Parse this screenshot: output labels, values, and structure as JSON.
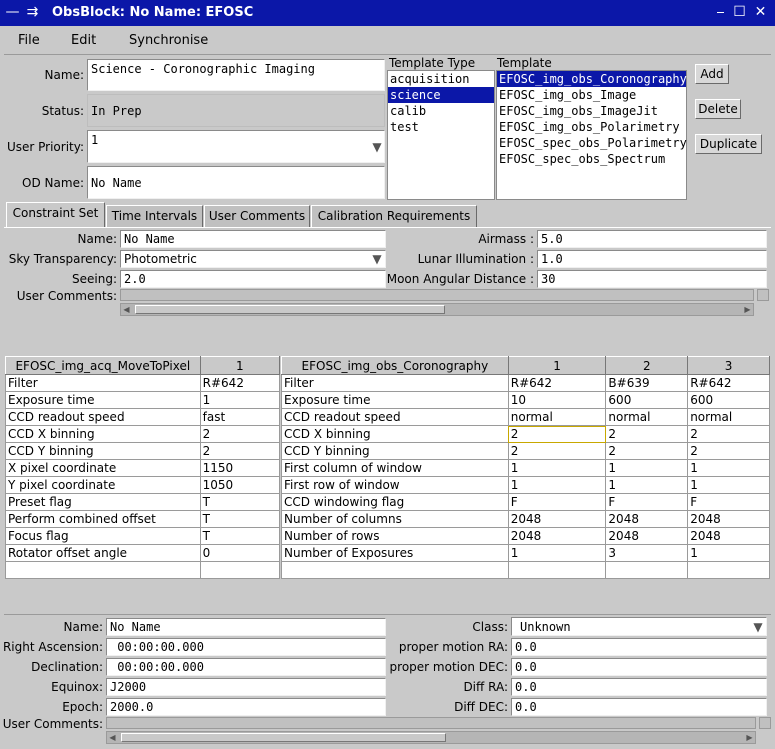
{
  "window": {
    "title": "ObsBlock: No Name: EFOSC"
  },
  "menu": [
    "File",
    "Edit",
    "Synchronise"
  ],
  "obsblock": {
    "name_label": "Name:",
    "name_value": "Science - Coronographic Imaging",
    "status_label": "Status:",
    "status_value": "In Prep",
    "priority_label": "User Priority:",
    "priority_value": "1",
    "odname_label": "OD Name:",
    "odname_value": "No Name"
  },
  "template_type": {
    "header": "Template Type",
    "items": [
      "acquisition",
      "science",
      "calib",
      "test"
    ],
    "selected": 1
  },
  "template": {
    "header": "Template",
    "items": [
      "EFOSC_img_obs_Coronography",
      "EFOSC_img_obs_Image",
      "EFOSC_img_obs_ImageJit",
      "EFOSC_img_obs_Polarimetry",
      "EFOSC_spec_obs_Polarimetry",
      "EFOSC_spec_obs_Spectrum"
    ],
    "selected": 0
  },
  "buttons": {
    "add": "Add",
    "delete": "Delete",
    "duplicate": "Duplicate"
  },
  "tabs": [
    "Constraint Set",
    "Time Intervals",
    "User Comments",
    "Calibration Requirements"
  ],
  "constraint": {
    "name_label": "Name:",
    "name_value": "No Name",
    "sky_label": "Sky Transparency:",
    "sky_value": "Photometric",
    "seeing_label": "Seeing:",
    "seeing_value": "2.0",
    "comments_label": "User Comments:",
    "airmass_label": "Airmass :",
    "airmass_value": "5.0",
    "lunar_label": "Lunar Illumination :",
    "lunar_value": "1.0",
    "moon_label": "Moon Angular Distance :",
    "moon_value": "30"
  },
  "acq_table": {
    "headers": [
      "EFOSC_img_acq_MoveToPixel",
      "1"
    ],
    "rows": [
      [
        "Filter",
        "R#642"
      ],
      [
        "Exposure time",
        "1"
      ],
      [
        "CCD readout speed",
        "fast"
      ],
      [
        "CCD X binning",
        "2"
      ],
      [
        "CCD Y binning",
        "2"
      ],
      [
        "X pixel coordinate",
        "1150"
      ],
      [
        "Y pixel coordinate",
        "1050"
      ],
      [
        "Preset flag",
        "T"
      ],
      [
        "Perform combined offset",
        "T"
      ],
      [
        "Focus flag",
        "T"
      ],
      [
        "Rotator offset angle",
        "0"
      ],
      [
        "",
        ""
      ]
    ]
  },
  "obs_table": {
    "headers": [
      "EFOSC_img_obs_Coronography",
      "1",
      "2",
      "3"
    ],
    "rows": [
      [
        "Filter",
        "R#642",
        "B#639",
        "R#642"
      ],
      [
        "Exposure time",
        "10",
        "600",
        "600"
      ],
      [
        "CCD readout speed",
        "normal",
        "normal",
        "normal"
      ],
      [
        "CCD X binning",
        "2",
        "2",
        "2"
      ],
      [
        "CCD Y binning",
        "2",
        "2",
        "2"
      ],
      [
        "First column of window",
        "1",
        "1",
        "1"
      ],
      [
        "First row of window",
        "1",
        "1",
        "1"
      ],
      [
        "CCD windowing flag",
        "F",
        "F",
        "F"
      ],
      [
        "Number of columns",
        "2048",
        "2048",
        "2048"
      ],
      [
        "Number of rows",
        "2048",
        "2048",
        "2048"
      ],
      [
        "Number of Exposures",
        "1",
        "3",
        "1"
      ],
      [
        "",
        "",
        "",
        ""
      ]
    ]
  },
  "target": {
    "name_label": "Name:",
    "name_value": "No Name",
    "ra_label": "Right Ascension:",
    "ra_value": " 00:00:00.000",
    "dec_label": "Declination:",
    "dec_value": " 00:00:00.000",
    "equinox_label": "Equinox:",
    "equinox_value": "J2000",
    "epoch_label": "Epoch:",
    "epoch_value": "2000.0",
    "comments_label": "User Comments:",
    "class_label": "Class:",
    "class_value": "Unknown",
    "pmra_label": "proper motion RA:",
    "pmra_value": "0.0",
    "pmdec_label": "proper motion DEC:",
    "pmdec_value": "0.0",
    "diffra_label": "Diff RA:",
    "diffra_value": "0.0",
    "diffdec_label": "Diff DEC:",
    "diffdec_value": "0.0"
  },
  "colors": {
    "titlebar": "#0b17a8",
    "selection": "#0b17a8",
    "background": "#c9c9c9"
  }
}
